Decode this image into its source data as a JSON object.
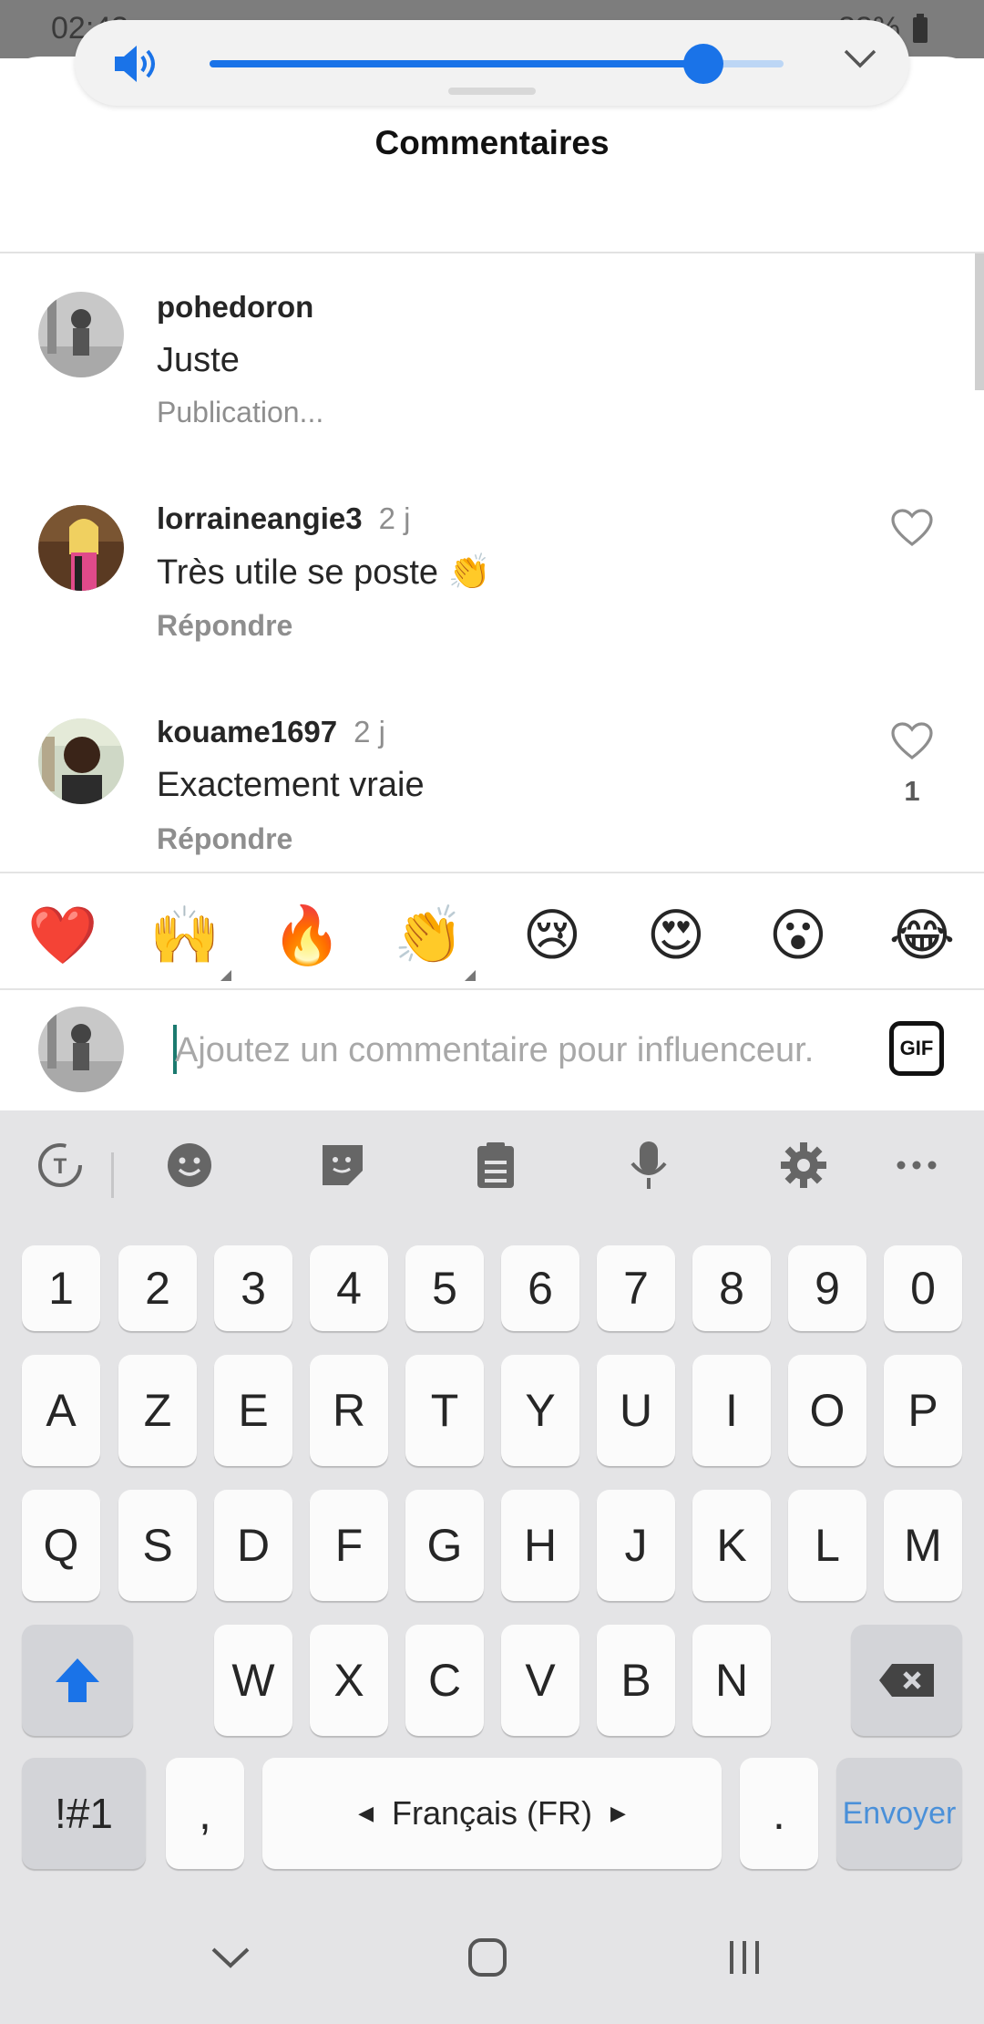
{
  "status_bar": {
    "time": "02:43",
    "battery": "88%"
  },
  "volume": {
    "level": 0.86
  },
  "sheet": {
    "title": "Commentaires"
  },
  "comments": [
    {
      "user": "pohedoron",
      "time": "",
      "text": "Juste",
      "sub": "Publication...",
      "likes": ""
    },
    {
      "user": "lorraineangie3",
      "time": "2 j",
      "text": "Très utile se poste 👏",
      "sub": "Répondre",
      "likes": ""
    },
    {
      "user": "kouame1697",
      "time": "2 j",
      "text": "Exactement vraie",
      "sub": "Répondre",
      "likes": "1"
    }
  ],
  "reactions": [
    "❤️",
    "🙌",
    "🔥",
    "👏",
    "😢",
    "😍",
    "😮",
    "😂"
  ],
  "input": {
    "placeholder": "Ajoutez un commentaire pour influenceur.",
    "gif_label": "GIF"
  },
  "keyboard": {
    "numbers": [
      "1",
      "2",
      "3",
      "4",
      "5",
      "6",
      "7",
      "8",
      "9",
      "0"
    ],
    "row1": [
      "A",
      "Z",
      "E",
      "R",
      "T",
      "Y",
      "U",
      "I",
      "O",
      "P"
    ],
    "row2": [
      "Q",
      "S",
      "D",
      "F",
      "G",
      "H",
      "J",
      "K",
      "L",
      "M"
    ],
    "row3": [
      "W",
      "X",
      "C",
      "V",
      "B",
      "N"
    ],
    "symbols_label": "!#1",
    "comma": ",",
    "space_label": "Français (FR)",
    "period": ".",
    "send_label": "Envoyer"
  },
  "colors": {
    "accent": "#1a73e8",
    "send": "#4a90d9"
  }
}
